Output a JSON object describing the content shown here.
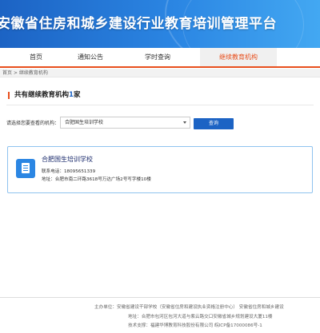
{
  "header": {
    "title": "安徽省住房和城乡建设行业教育培训管理平台"
  },
  "nav": {
    "items": [
      {
        "label": "首页"
      },
      {
        "label": "通知公告"
      },
      {
        "label": "学时查询"
      },
      {
        "label": "继续教育机构"
      }
    ],
    "active_index": 3
  },
  "breadcrumb": {
    "text": "首页 > 继续教育机构"
  },
  "summary": {
    "prefix": "共有继续教育机构",
    "count": "1",
    "suffix": "家"
  },
  "filter": {
    "label": "请选择您要查看的机构：",
    "selected": "合肥国生培训学校",
    "query_label": "查询"
  },
  "institutions": [
    {
      "name": "合肥国生培训学校",
      "phone_label": "联系电话：",
      "phone": "18095651339",
      "address_label": "地址：",
      "address": "合肥市南二环路3618号万达广场2号写字楼10楼"
    }
  ],
  "footer": {
    "line1": "主办单位：安徽省建设干部学校（安徽省住房和建设执业资格注册中心）    安徽省住房和城乡建设",
    "line2": "地址：合肥市包河区包河大道与紫云路交口安徽省城乡规划建设大厦11楼",
    "line3": "技术支撑：福建华博教育科技股份有限公司    皖ICP备17000086号-1"
  },
  "colors": {
    "brand_blue": "#1c63c4",
    "accent_orange": "#e84f1d",
    "card_border": "#8fc3ef"
  },
  "icons": {
    "institution": "document-icon",
    "select_caret": "chevron-down-icon"
  }
}
